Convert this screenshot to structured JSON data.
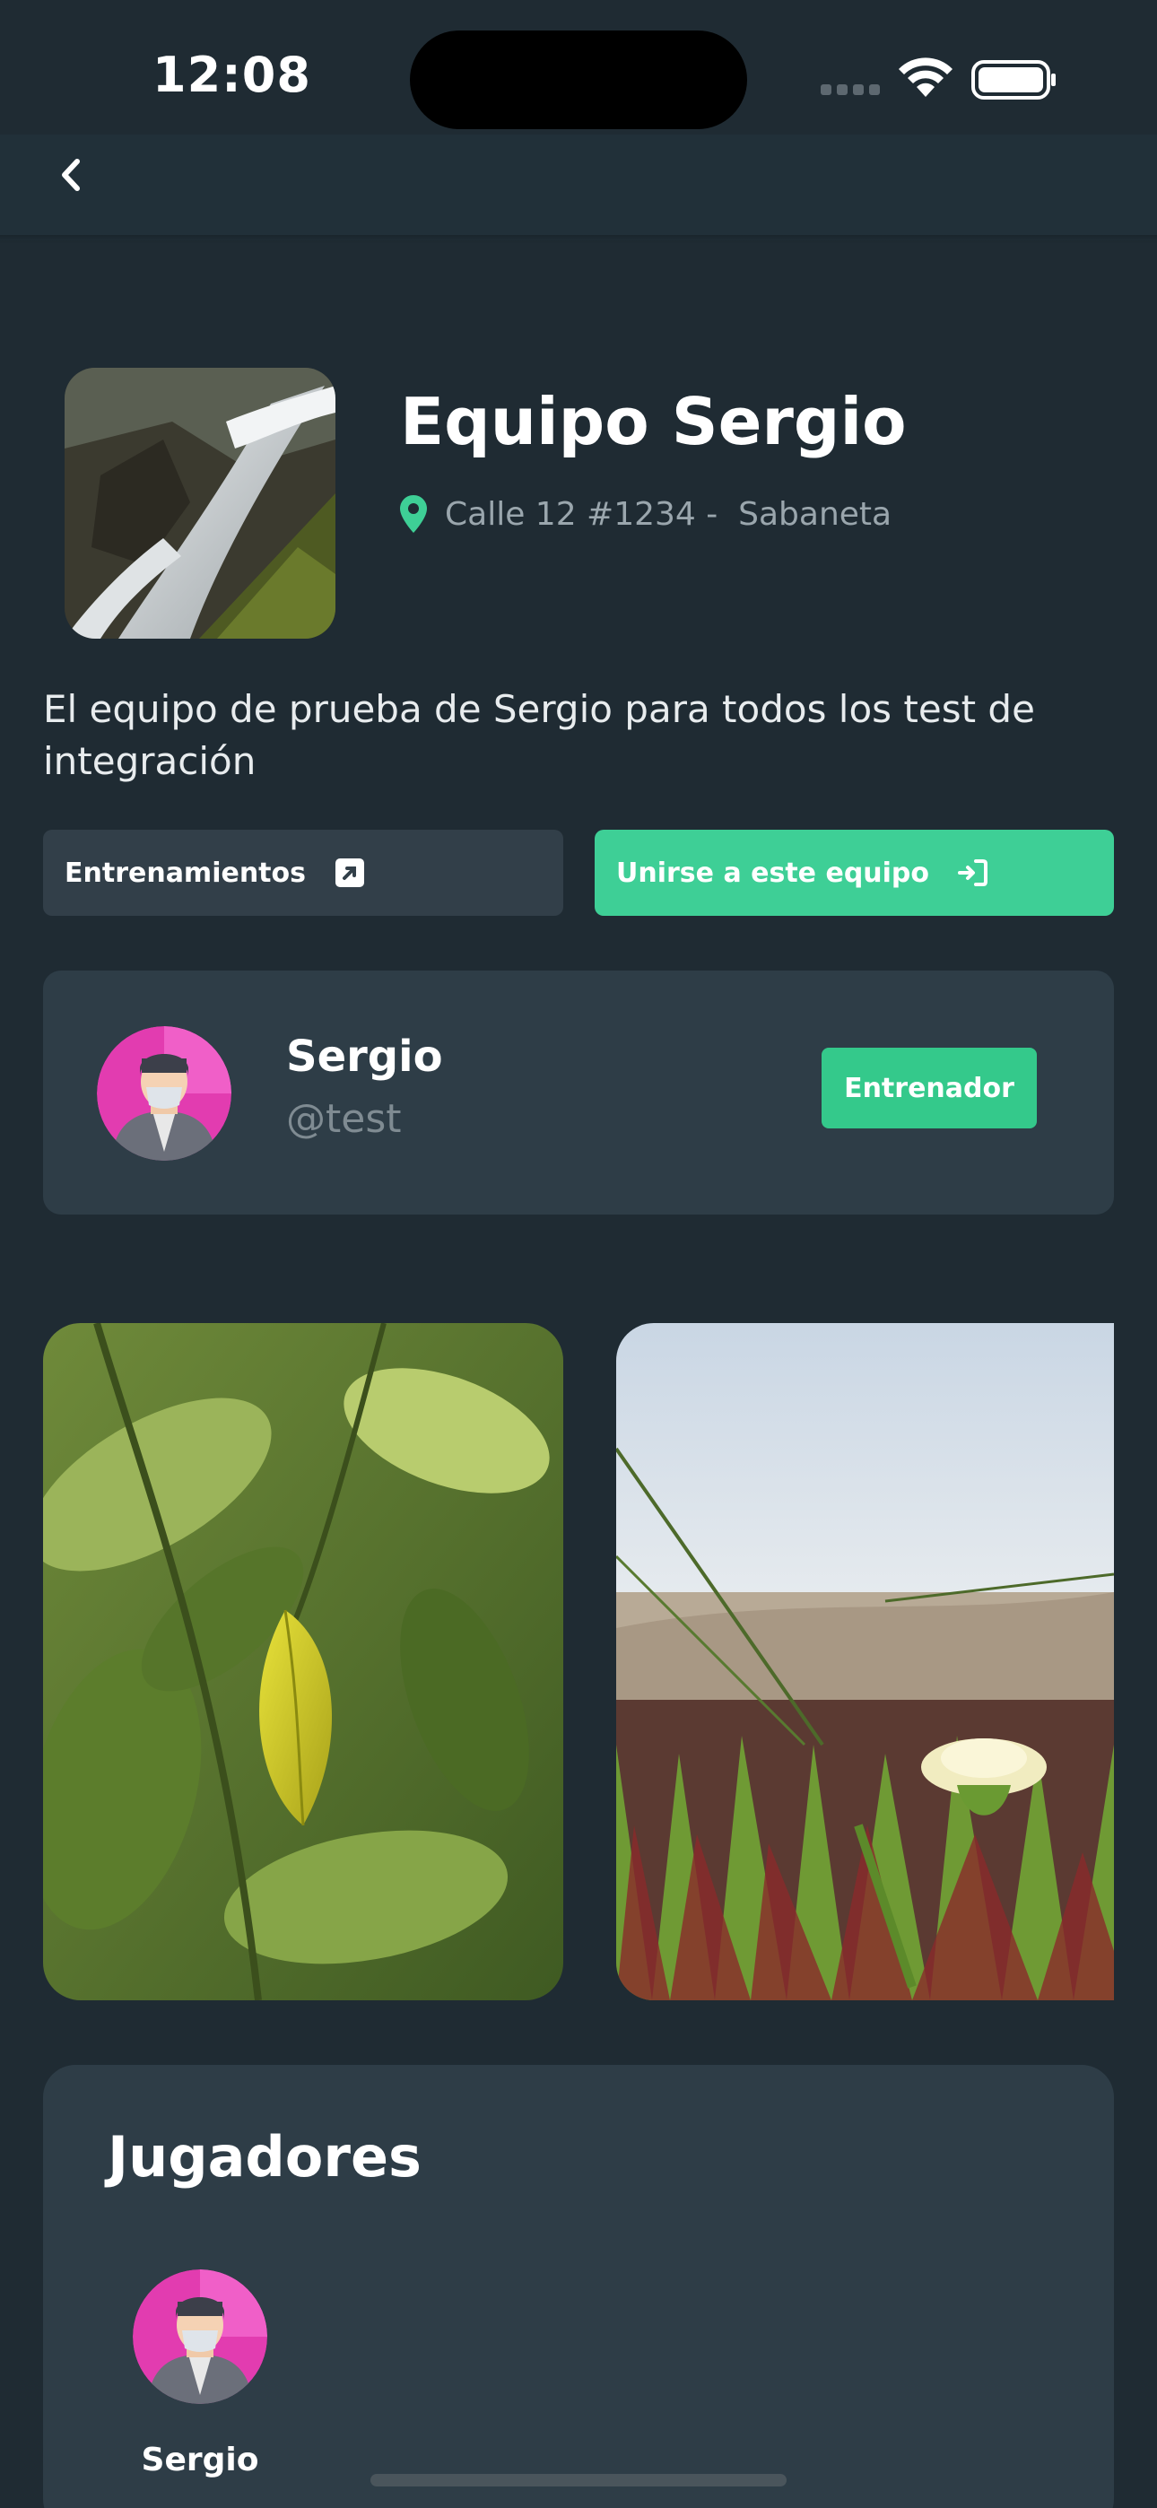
{
  "status_bar": {
    "time": "12:08"
  },
  "team": {
    "name": "Equipo Sergio",
    "address": "Calle 12 #1234 -  Sabaneta",
    "description": "El equipo de prueba de Sergio para todos los test de integración"
  },
  "actions": {
    "trainings_label": "Entrenamientos",
    "join_label": "Unirse a este equipo"
  },
  "coach": {
    "name": "Sergio",
    "handle": "@test",
    "role": "Entrenador"
  },
  "gallery": [
    "leaf-photo",
    "flower-dunes-photo"
  ],
  "players": {
    "title": "Jugadores",
    "items": [
      {
        "name": "Sergio"
      }
    ]
  },
  "colors": {
    "background": "#1f2b33",
    "card": "#2e3d47",
    "accent_green": "#3ecf96",
    "muted_text": "#9aa6ad"
  }
}
